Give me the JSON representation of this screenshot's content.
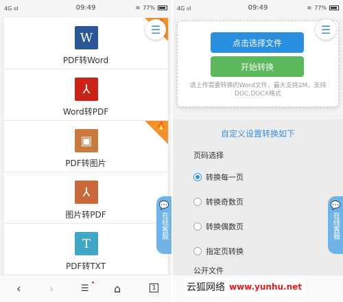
{
  "colors": {
    "word_tile": "#2b5797",
    "pdf_tile": "#c9241a",
    "image_tile": "#c97b3f",
    "img2pdf_tile": "#c9683a",
    "txt_tile": "#3fa7c4",
    "hot_badge": "#f0932b",
    "primary_button": "#2b8fe0",
    "start_button": "#5cb85c",
    "accent": "#3a8fd8"
  },
  "left": {
    "status": {
      "signal": "4G ııl",
      "time": "09:49",
      "battery_pct": "77%"
    },
    "menu_icon": "hamburger-menu-icon",
    "tools": [
      {
        "tile_text": "W",
        "label": "PDF转Word",
        "icon": "word-icon",
        "hot": true
      },
      {
        "tile_text": "⅄",
        "label": "Word转PDF",
        "icon": "pdf-icon",
        "hot": false
      },
      {
        "tile_text": "▣",
        "label": "PDF转图片",
        "icon": "image-icon",
        "hot": true
      },
      {
        "tile_text": "⅄",
        "label": "图片转PDF",
        "icon": "pdf-doc-icon",
        "hot": false
      },
      {
        "tile_text": "T",
        "label": "PDF转TXT",
        "icon": "txt-icon",
        "hot": false
      }
    ],
    "service_tab": "在线客服"
  },
  "right": {
    "status": {
      "signal": "4G ııl",
      "time": "09:49",
      "battery_pct": "77%"
    },
    "select_file": "点击选择文件",
    "start_convert": "开始转换",
    "hint": "请上传需要转换的Word文件，最大支持2M，支持DOC,DOCX格式",
    "settings_title": "自定义设置转换如下",
    "page_select_label": "页码选择",
    "options": [
      "转换每一页",
      "转换奇数页",
      "转换偶数页",
      "指定页转换"
    ],
    "selected_option_index": 0,
    "more_label": "公开文件",
    "service_tab": "在线客服"
  },
  "nav": {
    "back": "‹",
    "forward": "›",
    "menu": "☰",
    "home": "⌂",
    "tabs": "1"
  },
  "watermark": {
    "text": "云狐网络",
    "site": "www.yunhu.net"
  }
}
